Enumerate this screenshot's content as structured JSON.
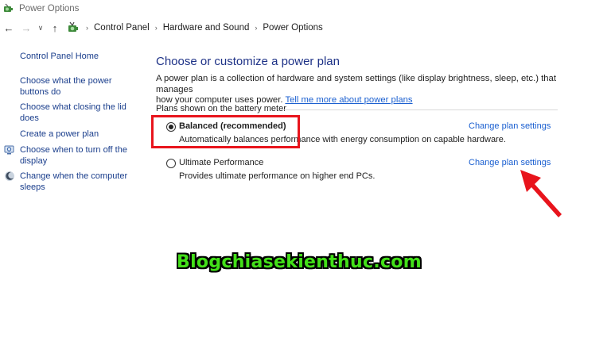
{
  "window": {
    "title": "Power Options"
  },
  "address": {
    "crumbs": [
      "Control Panel",
      "Hardware and Sound",
      "Power Options"
    ]
  },
  "sidebar": {
    "home_link": "Control Panel Home",
    "items": [
      {
        "line1": "Choose what the power",
        "line2": "buttons do",
        "icon": "none"
      },
      {
        "line1": "Choose what closing the lid",
        "line2": "does",
        "icon": "none"
      },
      {
        "line1": "Create a power plan",
        "line2": "",
        "icon": "none"
      },
      {
        "line1": "Choose when to turn off the",
        "line2": "display",
        "icon": "monitor-power-icon"
      },
      {
        "line1": "Change when the computer",
        "line2": "sleeps",
        "icon": "moon-sleep-icon"
      }
    ]
  },
  "main": {
    "heading": "Choose or customize a power plan",
    "description_line1": "A power plan is a collection of hardware and system settings (like display brightness, sleep, etc.) that manages",
    "description_line2": "how your computer uses power.",
    "description_link": "Tell me more about power plans",
    "group_label": "Plans shown on the battery meter",
    "plans": [
      {
        "name": "Balanced (recommended)",
        "description": "Automatically balances performance with energy consumption on capable hardware.",
        "selected": true,
        "change_link": "Change plan settings"
      },
      {
        "name": "Ultimate Performance",
        "description": "Provides ultimate performance on higher end PCs.",
        "selected": false,
        "change_link": "Change plan settings"
      }
    ]
  },
  "watermark": {
    "text": "Blogchiasekienthuc.com"
  },
  "colors": {
    "heading": "#1e3287",
    "link": "#1a5fd0",
    "highlight": "#e8141c",
    "watermark": "#43e019"
  }
}
